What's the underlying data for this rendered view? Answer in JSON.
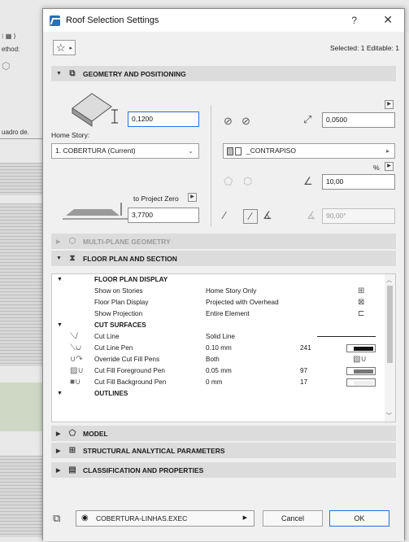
{
  "background": {
    "texts": [
      "ethod:",
      "uadro de."
    ]
  },
  "dialog": {
    "title": "Roof Selection Settings",
    "help": "?",
    "close": "✕",
    "selection_info": "Selected: 1 Editable: 1"
  },
  "sections": {
    "geometry": "GEOMETRY AND POSITIONING",
    "multiplane": "MULTI-PLANE GEOMETRY",
    "floorplan": "FLOOR PLAN AND SECTION",
    "model": "MODEL",
    "structural": "STRUCTURAL ANALYTICAL PARAMETERS",
    "classification": "CLASSIFICATION AND PROPERTIES"
  },
  "geometry": {
    "thickness": "0,1200",
    "home_story_label": "Home Story:",
    "home_story_value": "1. COBERTURA (Current)",
    "to_project_zero_label": "to Project Zero",
    "elevation": "3,7700",
    "edge_offset": "0,0500",
    "building_material": "_CONTRAPISO",
    "percent_label": "%",
    "pitch": "10,00",
    "angle": "90,00°"
  },
  "floor_plan": {
    "rows": [
      {
        "type": "group",
        "label": "FLOOR PLAN DISPLAY"
      },
      {
        "type": "item",
        "label": "Show on Stories",
        "value": "Home Story Only",
        "icon": "stories-icon"
      },
      {
        "type": "item",
        "label": "Floor Plan Display",
        "value": "Projected with Overhead",
        "icon": "display-icon"
      },
      {
        "type": "item",
        "label": "Show Projection",
        "value": "Entire Element",
        "icon": "projection-icon"
      },
      {
        "type": "group",
        "label": "CUT SURFACES"
      },
      {
        "type": "item",
        "label": "Cut Line",
        "value": "Solid Line",
        "pen": "",
        "kind": "line"
      },
      {
        "type": "item",
        "label": "Cut Line Pen",
        "value": "0.10 mm",
        "pen": "241",
        "kind": "pen"
      },
      {
        "type": "item",
        "label": "Override Cut Fill Pens",
        "value": "Both",
        "pen": "",
        "kind": "override"
      },
      {
        "type": "item",
        "label": "Cut Fill Foreground Pen",
        "value": "0.05 mm",
        "pen": "97",
        "kind": "pen"
      },
      {
        "type": "item",
        "label": "Cut Fill Background Pen",
        "value": "0 mm",
        "pen": "17",
        "kind": "pen-empty"
      },
      {
        "type": "group",
        "label": "OUTLINES"
      }
    ]
  },
  "bottom": {
    "favorite": "COBERTURA-LINHAS.EXEC",
    "cancel": "Cancel",
    "ok": "OK"
  }
}
